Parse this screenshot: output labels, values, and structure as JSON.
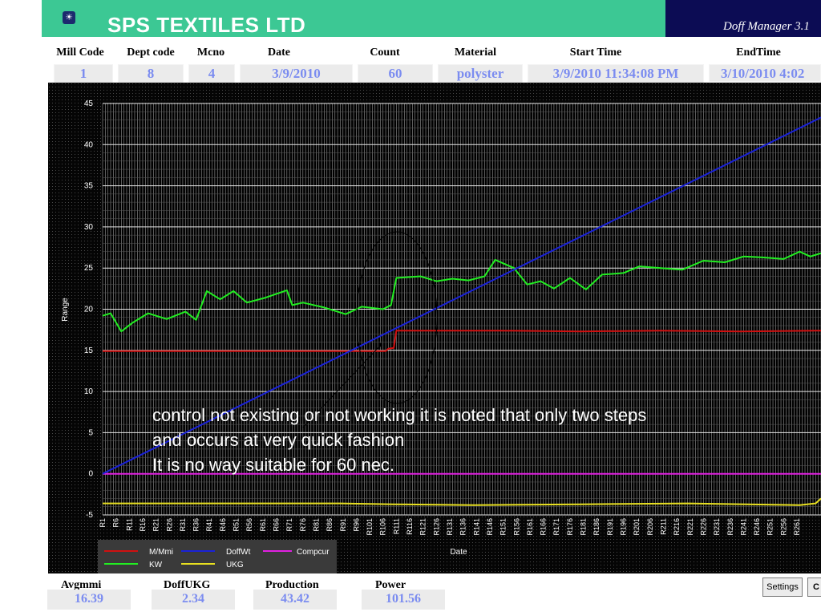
{
  "app": {
    "title": "SPS TEXTILES LTD",
    "brand": "Doff Manager 3.1"
  },
  "header": {
    "labels": [
      "Mill Code",
      "Dept code",
      "Mcno",
      "Date",
      "Count",
      "Material",
      "Start Time",
      "EndTime"
    ],
    "values": [
      "1",
      "8",
      "4",
      "3/9/2010",
      "60",
      "polyster",
      "3/9/2010 11:34:08 PM",
      "3/10/2010 4:02"
    ]
  },
  "footer": {
    "labels": [
      "Avgmmi",
      "DoffUKG",
      "Production",
      "Power"
    ],
    "values": [
      "16.39",
      "2.34",
      "43.42",
      "101.56"
    ],
    "buttons": [
      "Settings",
      "C"
    ]
  },
  "colors": {
    "title_bg": "#3cc894",
    "brand_bg": "#0c0c54",
    "mmi": "#d01010",
    "kw": "#22ee22",
    "doffwt": "#1a22d8",
    "ukg": "#e8e020",
    "compcur": "#e020e0",
    "value_text": "#7b8cf0"
  },
  "chart_data": {
    "type": "line",
    "ylabel": "Range",
    "xlabel": "Date",
    "ylim": [
      -5,
      45
    ],
    "yticks": [
      45,
      40,
      35,
      30,
      25,
      20,
      15,
      10,
      5,
      0,
      -5
    ],
    "xticks": [
      "R1",
      "R6",
      "R11",
      "R16",
      "R21",
      "R26",
      "R31",
      "R36",
      "R41",
      "R46",
      "R51",
      "R56",
      "R61",
      "R66",
      "R71",
      "R76",
      "R81",
      "R86",
      "R91",
      "R96",
      "R101",
      "R106",
      "R111",
      "R116",
      "R121",
      "R126",
      "R131",
      "R136",
      "R141",
      "R146",
      "R151",
      "R156",
      "R161",
      "R166",
      "R171",
      "R176",
      "R181",
      "R186",
      "R191",
      "R196",
      "R201",
      "R206",
      "R211",
      "R216",
      "R221",
      "R226",
      "R231",
      "R236",
      "R241",
      "R246",
      "R251",
      "R256",
      "R261"
    ],
    "x_range": [
      1,
      270
    ],
    "grid": true,
    "legend_position": "bottom-left",
    "series": [
      {
        "name": "M/Mmi",
        "points": [
          [
            1,
            14.9
          ],
          [
            30,
            14.9
          ],
          [
            60,
            14.9
          ],
          [
            90,
            14.9
          ],
          [
            107,
            14.9
          ],
          [
            108,
            15.2
          ],
          [
            110,
            15.3
          ],
          [
            111,
            17.4
          ],
          [
            120,
            17.4
          ],
          [
            150,
            17.4
          ],
          [
            180,
            17.3
          ],
          [
            210,
            17.4
          ],
          [
            240,
            17.3
          ],
          [
            270,
            17.4
          ]
        ]
      },
      {
        "name": "DoffWt",
        "points": [
          [
            1,
            0
          ],
          [
            270,
            43.3
          ]
        ]
      },
      {
        "name": "Compcur",
        "points": [
          [
            1,
            0
          ],
          [
            270,
            0
          ]
        ]
      },
      {
        "name": "KW",
        "points": [
          [
            1,
            19.2
          ],
          [
            4,
            19.5
          ],
          [
            8,
            17.3
          ],
          [
            12,
            18.3
          ],
          [
            18,
            19.5
          ],
          [
            25,
            18.8
          ],
          [
            32,
            19.7
          ],
          [
            36,
            18.7
          ],
          [
            40,
            22.2
          ],
          [
            45,
            21.2
          ],
          [
            50,
            22.2
          ],
          [
            55,
            20.8
          ],
          [
            62,
            21.4
          ],
          [
            70,
            22.3
          ],
          [
            72,
            20.5
          ],
          [
            76,
            20.8
          ],
          [
            84,
            20.2
          ],
          [
            92,
            19.4
          ],
          [
            98,
            20.3
          ],
          [
            106,
            20.0
          ],
          [
            109,
            20.5
          ],
          [
            111,
            23.8
          ],
          [
            120,
            24.0
          ],
          [
            126,
            23.4
          ],
          [
            132,
            23.7
          ],
          [
            138,
            23.5
          ],
          [
            144,
            24.0
          ],
          [
            148,
            26.0
          ],
          [
            155,
            25.0
          ],
          [
            160,
            23.0
          ],
          [
            165,
            23.4
          ],
          [
            170,
            22.5
          ],
          [
            176,
            23.8
          ],
          [
            182,
            22.4
          ],
          [
            188,
            24.2
          ],
          [
            196,
            24.4
          ],
          [
            202,
            25.2
          ],
          [
            210,
            25.0
          ],
          [
            218,
            24.8
          ],
          [
            226,
            25.9
          ],
          [
            234,
            25.7
          ],
          [
            241,
            26.4
          ],
          [
            248,
            26.3
          ],
          [
            256,
            26.1
          ],
          [
            262,
            27.0
          ],
          [
            266,
            26.4
          ],
          [
            270,
            26.8
          ]
        ]
      },
      {
        "name": "UKG",
        "points": [
          [
            1,
            -3.6
          ],
          [
            90,
            -3.6
          ],
          [
            110,
            -3.7
          ],
          [
            140,
            -3.8
          ],
          [
            180,
            -3.7
          ],
          [
            220,
            -3.6
          ],
          [
            262,
            -3.8
          ],
          [
            268,
            -3.6
          ],
          [
            270,
            -3.0
          ]
        ]
      }
    ],
    "annotations": [
      "control not existing or not working  it is noted that only two steps",
      "and occurs at very quick fashion",
      "It is no way suitable for 60 nec."
    ]
  }
}
